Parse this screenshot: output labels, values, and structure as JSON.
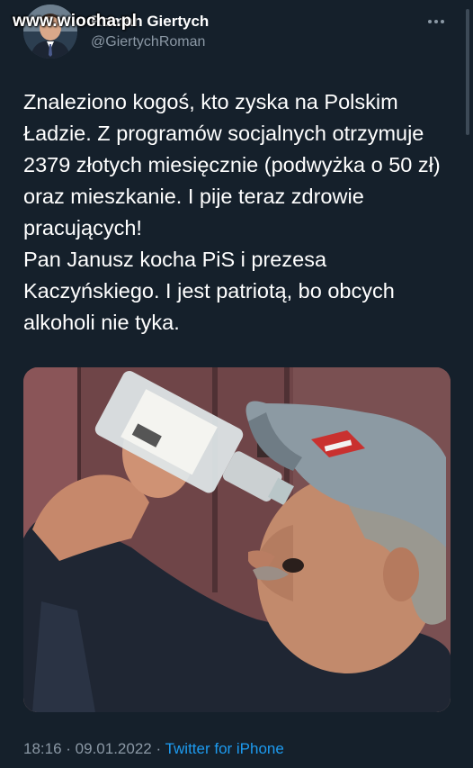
{
  "watermark": "www.wiocha.pl",
  "author": {
    "display_name": "Roman Giertych",
    "handle": "@GiertychRoman"
  },
  "more_icon": "more-horizontal-icon",
  "tweet": {
    "lines": [
      "Znaleziono kogoś, kto zyska na Polskim Ładzie. Z programów socjalnych otrzymuje 2379 złotych miesięcznie (podwyżka o 50 zł) oraz mieszkanie. I pije teraz zdrowie pracujących!",
      "Pan Janusz kocha PiS i prezesa Kaczyńskiego. I jest patriotą, bo obcych alkoholi nie tyka."
    ]
  },
  "meta": {
    "time": "18:16",
    "separator1": " · ",
    "date": "09.01.2022",
    "separator2": " · ",
    "source": "Twitter for iPhone"
  },
  "colors": {
    "background": "#15202b",
    "text": "#ffffff",
    "secondary": "#8b98a5",
    "link": "#1d9bf0"
  }
}
